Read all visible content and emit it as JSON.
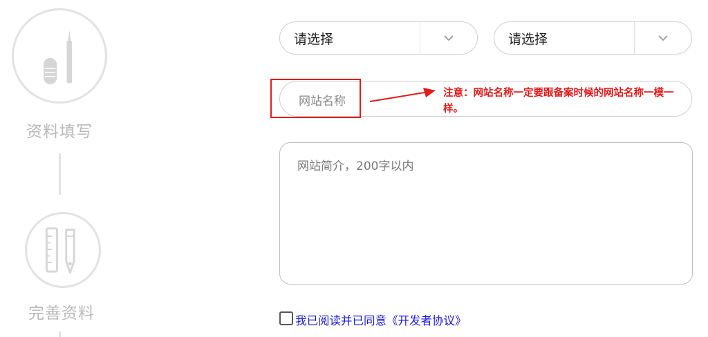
{
  "steps": [
    {
      "label": "资料填写",
      "icon": "pencil-icon"
    },
    {
      "label": "完善资料",
      "icon": "ruler-pen-icon"
    }
  ],
  "form": {
    "select_1": {
      "value": "请选择"
    },
    "select_2": {
      "value": "请选择"
    },
    "site_name": {
      "placeholder": "网站名称"
    },
    "site_description": {
      "placeholder": "网站简介，200字以内"
    },
    "agreement": {
      "label": "我已阅读并已同意《开发者协议》",
      "checked": false
    }
  },
  "annotation": {
    "note": "注意：网站名称一定要跟备案时候的网站名称一模一样。",
    "color": "#e21b1b"
  },
  "colors": {
    "step_inactive": "#d0d0d0",
    "link": "#1a1ad6"
  }
}
